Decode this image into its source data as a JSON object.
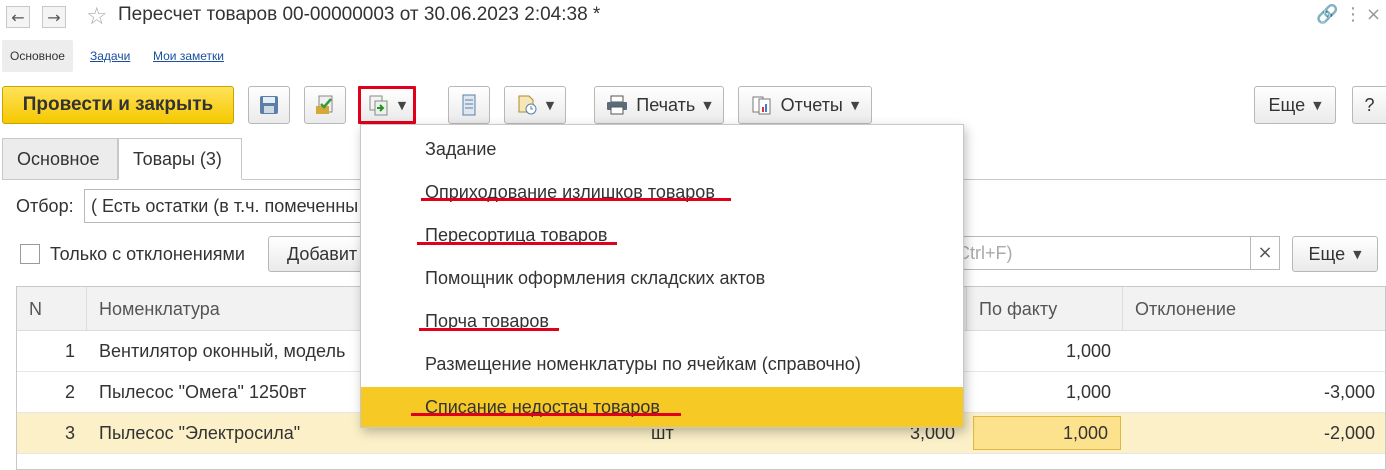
{
  "window": {
    "title": "Пересчет товаров 00-00000003 от 30.06.2023 2:04:38 *"
  },
  "sections": {
    "main": "Основное",
    "tasks": "Задачи",
    "notes": "Мои заметки"
  },
  "toolbar": {
    "post_close": "Провести и закрыть",
    "print": "Печать",
    "reports": "Отчеты",
    "more": "Еще",
    "help": "?"
  },
  "tabs": {
    "main": "Основное",
    "goods": "Товары (3)"
  },
  "filter": {
    "label": "Отбор:",
    "value": "( Есть остатки (в т.ч. помеченны",
    "only_deviations": "Только с отклонениями",
    "add": "Добавит",
    "search_placeholder": "Ctrl+F)",
    "clear": "×",
    "more": "Еще"
  },
  "table": {
    "columns": {
      "n": "N",
      "item": "Номенклатура",
      "fact": "По факту",
      "deviation": "Отклонение"
    },
    "rows": [
      {
        "n": "1",
        "item": "Вентилятор оконный, модель",
        "unit": "",
        "qty": "",
        "fact": "1,000",
        "deviation": ""
      },
      {
        "n": "2",
        "item": "Пылесос \"Омега\" 1250вт",
        "unit": "",
        "qty": "",
        "fact": "1,000",
        "deviation": "-3,000"
      },
      {
        "n": "3",
        "item": "Пылесос \"Электросила\"",
        "unit": "шт",
        "qty": "3,000",
        "fact": "1,000",
        "deviation": "-2,000"
      }
    ]
  },
  "menu": {
    "items": [
      "Задание",
      "Оприходование излишков товаров",
      "Пересортица товаров",
      "Помощник оформления складских актов",
      "Порча товаров",
      "Размещение номенклатуры по ячейкам (справочно)",
      "Списание недостач товаров"
    ]
  },
  "colors": {
    "primary_button": "#f5c800",
    "menu_highlight": "#f7c924",
    "annotation_red": "#e0001b",
    "selected_row": "#fbf0c8"
  }
}
